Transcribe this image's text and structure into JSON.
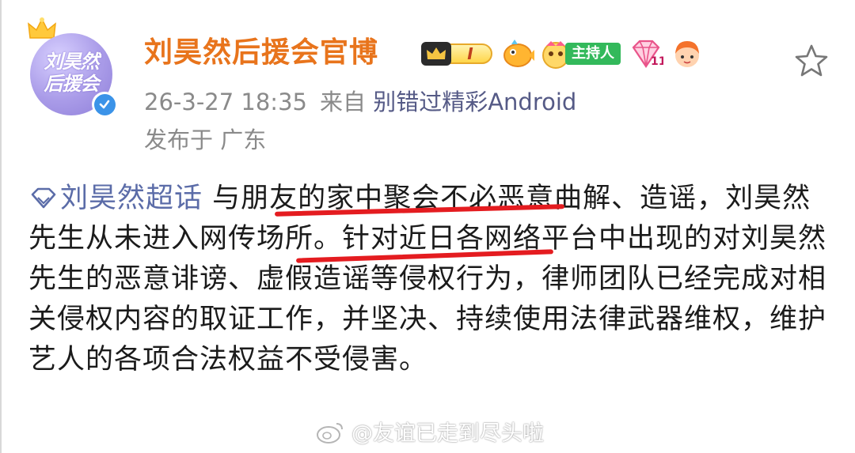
{
  "post": {
    "author_name": "刘昊然后援会官博",
    "avatar_text": [
      "刘昊然",
      "后援会"
    ],
    "level_badge": "I",
    "host_badge_label": "主持人",
    "timestamp": "26-3-27 18:35",
    "source_prefix": "来自",
    "source": "别错过精彩Android",
    "location": "发布于 广东",
    "topic": "刘昊然超话",
    "content_part1": " 与朋友的家中聚会不必恶意曲解、造谣，刘昊然先生从未进入网传场所。",
    "content_part2": "针对近日各网络平台中出现的对刘昊然先生的恶意诽谤、虚假造谣等侵权行为，律师团队已经完成对相关侵权内容的取证工作，并坚决、持续使用法律武器维权，维护艺人的各项合法权益不受侵害。",
    "watermark": "@友谊已走到尽头啦"
  },
  "colors": {
    "author": "#e8741c",
    "topic": "#5b6ca8",
    "source": "#555a86",
    "meta": "#8a8a8a",
    "highlight_line": "#e41c20",
    "verified": "#3b93e8"
  },
  "icons": [
    "crown-icon",
    "verified-icon",
    "level-badge-icon",
    "fish-badge-icon",
    "host-badge-icon",
    "gem-badge-icon",
    "girl-badge-icon",
    "star-icon",
    "supertopic-diamond-icon",
    "weibo-logo-icon"
  ]
}
